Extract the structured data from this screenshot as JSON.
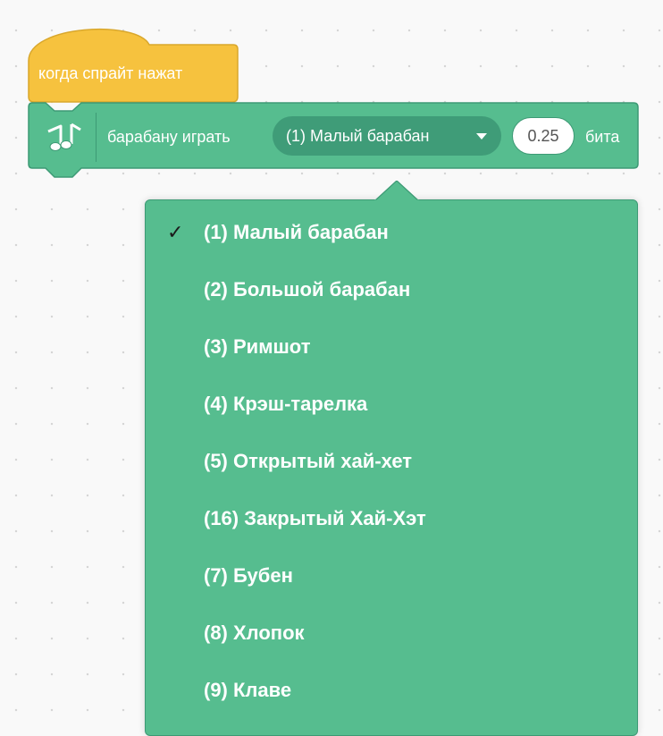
{
  "hat_block": {
    "label": "когда спрайт нажат",
    "color": "#f6c23e"
  },
  "music_block": {
    "icon": "music-notes-icon",
    "prefix_label": "барабану играть",
    "drum_selected": "(1) Малый барабан",
    "beats_value": "0.25",
    "suffix_label": "бита",
    "color": "#56bd8f"
  },
  "dropdown": {
    "items": [
      {
        "label": "(1) Малый барабан",
        "checked": true,
        "check_mark": "✓"
      },
      {
        "label": "(2) Большой барабан"
      },
      {
        "label": "(3) Римшот"
      },
      {
        "label": "(4) Крэш-тарелка"
      },
      {
        "label": "(5) Открытый хай-хет"
      },
      {
        "label": "(16) Закрытый Хай-Хэт"
      },
      {
        "label": "(7) Бубен"
      },
      {
        "label": "(8) Хлопок"
      },
      {
        "label": "(9) Клаве"
      }
    ]
  }
}
